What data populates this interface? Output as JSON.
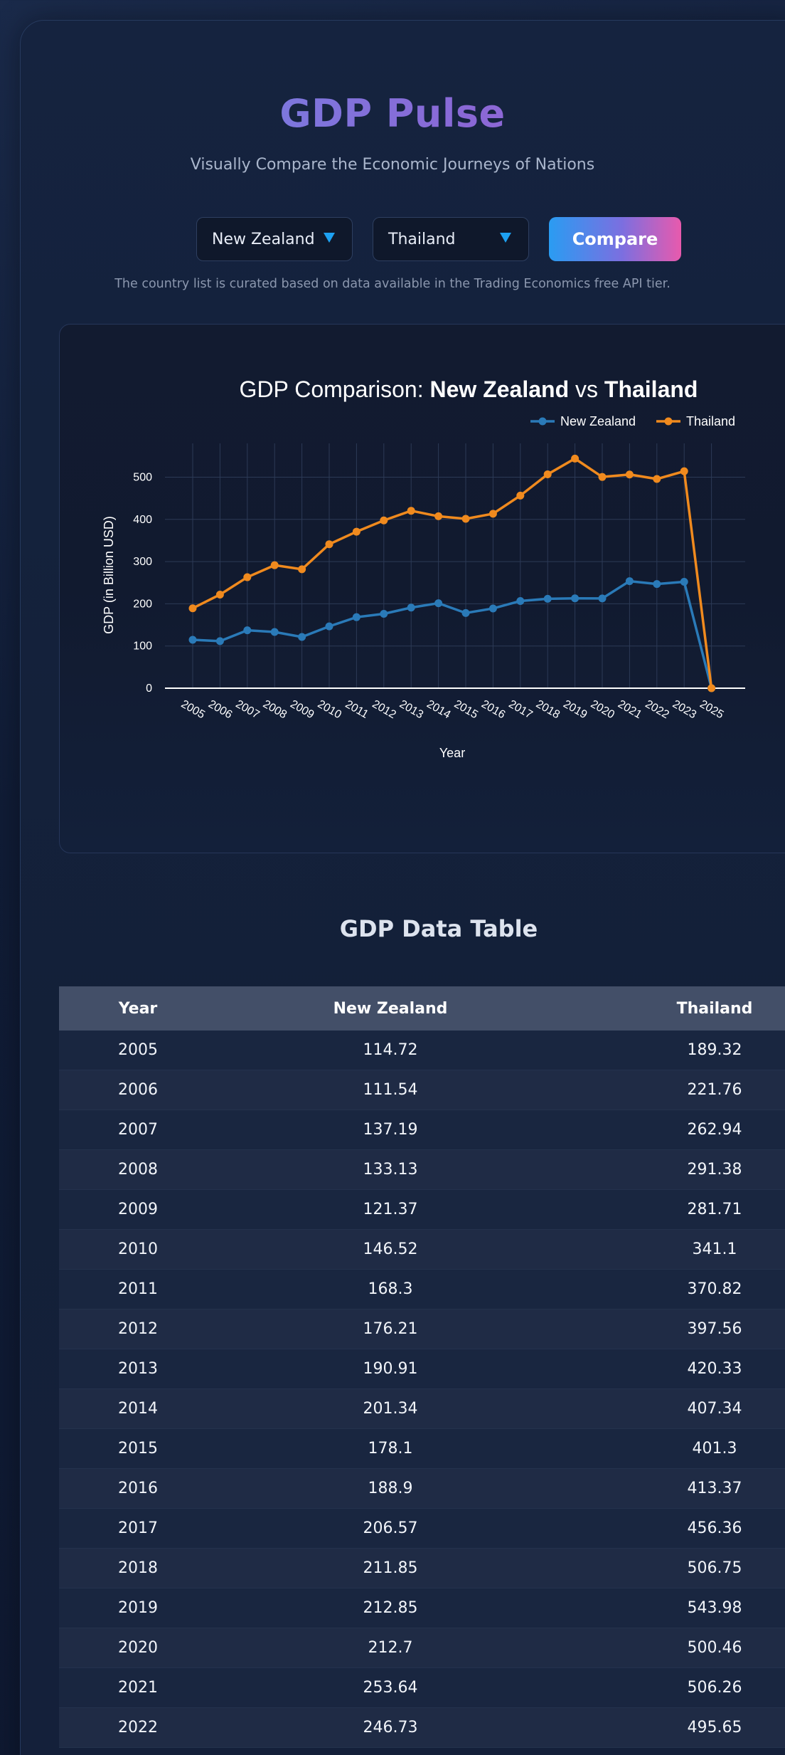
{
  "app": {
    "title": "GDP Pulse",
    "subtitle": "Visually Compare the Economic Journeys of Nations",
    "note": "The country list is curated based on data available in the Trading Economics free API tier."
  },
  "controls": {
    "country1": "New Zealand",
    "country2": "Thailand",
    "compare_label": "Compare"
  },
  "colors": {
    "series1": "#2a7ab8",
    "series2": "#f08a1e",
    "accent_caret": "#1da1f2"
  },
  "chart_data": {
    "type": "line",
    "title_prefix": "GDP Comparison: ",
    "title_country1": "New Zealand",
    "title_vs": " vs ",
    "title_country2": "Thailand",
    "xlabel": "Year",
    "ylabel": "GDP (in Billion USD)",
    "ylim": [
      0,
      580
    ],
    "yticks": [
      0,
      100,
      200,
      300,
      400,
      500
    ],
    "grid": true,
    "legend": "top-right",
    "x": [
      "2005",
      "2006",
      "2007",
      "2008",
      "2009",
      "2010",
      "2011",
      "2012",
      "2013",
      "2014",
      "2015",
      "2016",
      "2017",
      "2018",
      "2019",
      "2020",
      "2021",
      "2022",
      "2023",
      "2025"
    ],
    "series": [
      {
        "name": "New Zealand",
        "values": [
          114.72,
          111.54,
          137.19,
          133.13,
          121.37,
          146.52,
          168.3,
          176.21,
          190.91,
          201.34,
          178.1,
          188.9,
          206.57,
          211.85,
          212.85,
          212.7,
          253.64,
          246.73,
          252.0,
          0
        ]
      },
      {
        "name": "Thailand",
        "values": [
          189.32,
          221.76,
          262.94,
          291.38,
          281.71,
          341.1,
          370.82,
          397.56,
          420.33,
          407.34,
          401.3,
          413.37,
          456.36,
          506.75,
          543.98,
          500.46,
          506.26,
          495.65,
          514.0,
          0
        ]
      }
    ]
  },
  "table": {
    "title": "GDP Data Table",
    "headers": [
      "Year",
      "New Zealand",
      "Thailand"
    ],
    "rows": [
      [
        "2005",
        "114.72",
        "189.32"
      ],
      [
        "2006",
        "111.54",
        "221.76"
      ],
      [
        "2007",
        "137.19",
        "262.94"
      ],
      [
        "2008",
        "133.13",
        "291.38"
      ],
      [
        "2009",
        "121.37",
        "281.71"
      ],
      [
        "2010",
        "146.52",
        "341.1"
      ],
      [
        "2011",
        "168.3",
        "370.82"
      ],
      [
        "2012",
        "176.21",
        "397.56"
      ],
      [
        "2013",
        "190.91",
        "420.33"
      ],
      [
        "2014",
        "201.34",
        "407.34"
      ],
      [
        "2015",
        "178.1",
        "401.3"
      ],
      [
        "2016",
        "188.9",
        "413.37"
      ],
      [
        "2017",
        "206.57",
        "456.36"
      ],
      [
        "2018",
        "211.85",
        "506.75"
      ],
      [
        "2019",
        "212.85",
        "543.98"
      ],
      [
        "2020",
        "212.7",
        "500.46"
      ],
      [
        "2021",
        "253.64",
        "506.26"
      ],
      [
        "2022",
        "246.73",
        "495.65"
      ]
    ]
  }
}
